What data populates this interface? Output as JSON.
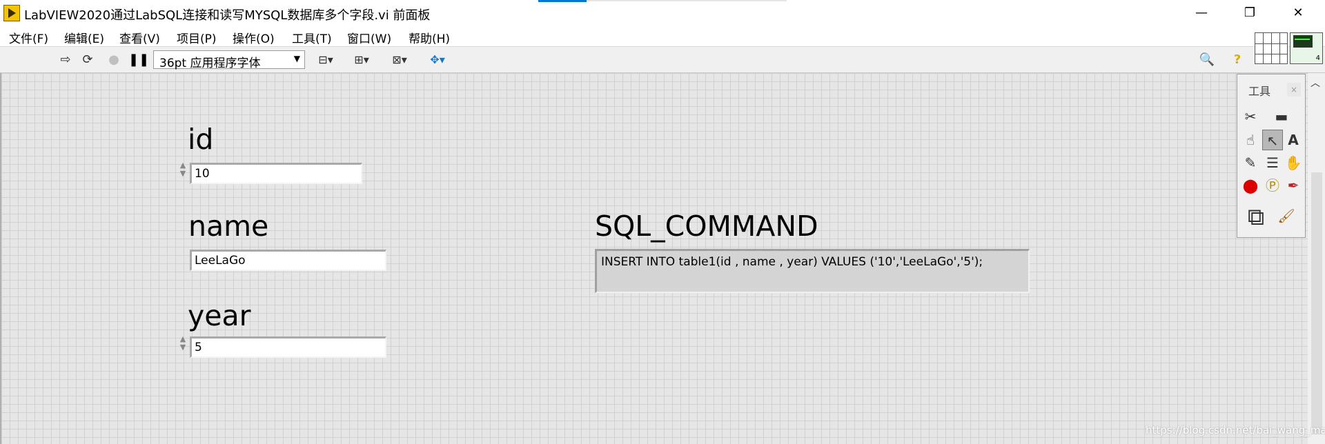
{
  "window": {
    "title": "LabVIEW2020通过LabSQL连接和读写MYSQL数据库多个字段.vi 前面板",
    "minimize_icon": "—",
    "maximize_icon": "❐",
    "close_icon": "✕"
  },
  "menu": [
    "文件(F)",
    "编辑(E)",
    "查看(V)",
    "项目(P)",
    "操作(O)",
    "工具(T)",
    "窗口(W)",
    "帮助(H)"
  ],
  "toolbar": {
    "font_selector": "36pt 应用程序字体",
    "icons": [
      "run-arrow-icon",
      "run-continuously-icon",
      "abort-icon",
      "pause-icon",
      "align-icon",
      "distribute-icon",
      "resize-icon",
      "reorder-icon",
      "search-icon",
      "help-icon"
    ]
  },
  "vi_icon_number": "4",
  "controls": {
    "id": {
      "label": "id",
      "value": "10"
    },
    "name": {
      "label": "name",
      "value": "LeeLaGo"
    },
    "year": {
      "label": "year",
      "value": "5"
    }
  },
  "indicator": {
    "label": "SQL_COMMAND",
    "value": "INSERT INTO table1(id , name , year)  VALUES ('10','LeeLaGo','5');"
  },
  "tools_palette": {
    "title": "工具",
    "close": "×"
  },
  "watermark": "https://blog.csdn.net/bai_wang_mao"
}
